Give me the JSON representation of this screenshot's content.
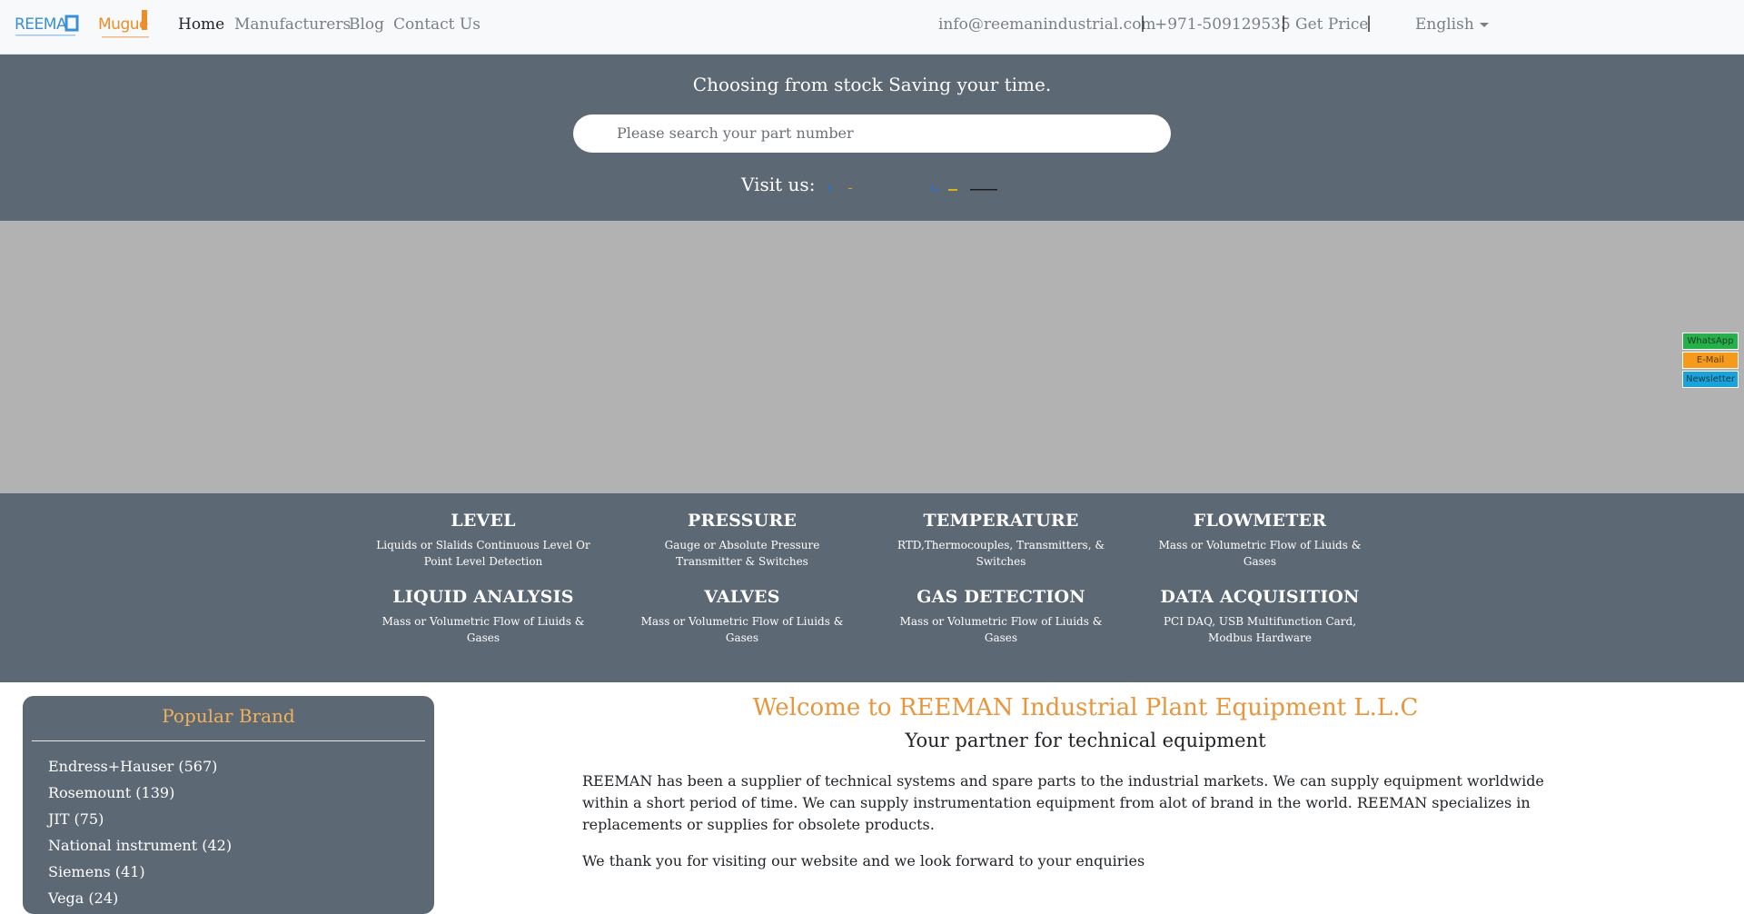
{
  "navbar": {
    "links": [
      "Home",
      "Manufacturers",
      "Blog",
      "Contact Us"
    ],
    "email": "info@reemanindustrial.com",
    "phone": "+971-509129535",
    "get_price": "Get Price",
    "separator": "|",
    "language": "English",
    "logo_reeman_text": "REEMAN",
    "logo_muguet_text": "Muguet"
  },
  "hero": {
    "tagline": "Choosing from stock Saving your time.",
    "search_placeholder": "Please search your part number",
    "visit_label": "Visit us:"
  },
  "categories": [
    {
      "title": "LEVEL",
      "desc": "Liquids or Slalids Continuous Level Or Point Level Detection"
    },
    {
      "title": "PRESSURE",
      "desc": "Gauge or Absolute Pressure Transmitter & Switches"
    },
    {
      "title": "TEMPERATURE",
      "desc": "RTD,Thermocouples, Transmitters, & Switches"
    },
    {
      "title": "FLOWMETER",
      "desc": "Mass or Volumetric Flow of Liuids & Gases"
    },
    {
      "title": "LIQUID ANALYSIS",
      "desc": "Mass or Volumetric Flow of Liuids & Gases"
    },
    {
      "title": "VALVES",
      "desc": "Mass or Volumetric Flow of Liuids & Gases"
    },
    {
      "title": "GAS DETECTION",
      "desc": "Mass or Volumetric Flow of Liuids & Gases"
    },
    {
      "title": "DATA ACQUISITION",
      "desc": "PCI DAQ, USB Multifunction Card, Modbus Hardware"
    }
  ],
  "side_widget": {
    "whatsapp": "WhatsApp",
    "email": "E-Mail",
    "newsletter": "Newsletter"
  },
  "popular_brand": {
    "title": "Popular Brand",
    "items": [
      "Endress+Hauser (567)",
      "Rosemount (139)",
      "JIT (75)",
      "National instrument (42)",
      "Siemens (41)",
      "Vega (24)"
    ]
  },
  "welcome": {
    "title": "Welcome to REEMAN Industrial Plant Equipment L.L.C",
    "subtitle": "Your partner for technical equipment",
    "p1": "REEMAN has been a supplier of technical systems and spare parts to the industrial markets. We can supply equipment worldwide within a short period of time. We can supply instrumentation equipment from alot of brand in the world. REEMAN specializes in replacements or supplies for obsolete products.",
    "p2": "We thank you for visiting our website and we look forward to your enquiries"
  },
  "colors": {
    "hero_bg": "#5d6875",
    "accent_orange": "#e8963e",
    "brand_title": "#f0b25a",
    "banner_gray": "#b2b2b2"
  }
}
